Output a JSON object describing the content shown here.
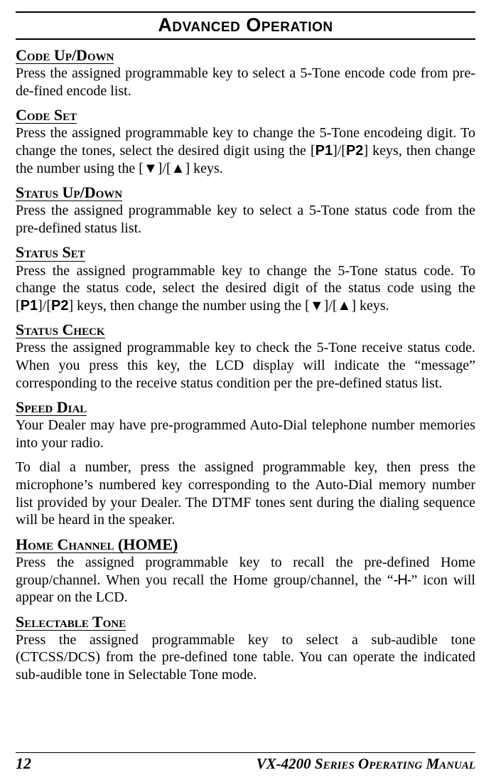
{
  "title": "Advanced Operation",
  "footer": {
    "page": "12",
    "manual": "VX-4200 Series Operating Manual"
  },
  "sections": {
    "codeUpDown": {
      "heading": "Code Up/Down",
      "p1": "Press the assigned programmable key to select a 5-Tone encode code from pre-de-fined encode list."
    },
    "codeSet": {
      "heading": "Code Set",
      "p1a": "Press the assigned programmable key to change the 5-Tone encodeing digit. To change the tones, select the desired digit using the [",
      "p1b": "]/[",
      "p1c": "] keys, then change the number using the [",
      "p1d": "]/[",
      "p1e": "] keys.",
      "keyP1": "P1",
      "keyP2": "P2"
    },
    "statusUpDown": {
      "heading": "Status Up/Down",
      "p1": "Press the assigned programmable key to select a 5-Tone status code from the pre-defined status list."
    },
    "statusSet": {
      "heading": "Status Set",
      "p1a": "Press the assigned programmable key to change the 5-Tone status code. To change the status code, select the desired digit of the status code using the [",
      "p1b": "]/[",
      "p1c": "] keys, then change the number using the [",
      "p1d": "]/[",
      "p1e": "] keys.",
      "keyP1": "P1",
      "keyP2": "P2"
    },
    "statusCheck": {
      "heading": "Status Check",
      "p1": "Press the assigned programmable key to check the 5-Tone receive status code. When you press this key, the LCD display will indicate the “message” corresponding to the receive status condition per the pre-defined status list."
    },
    "speedDial": {
      "heading": "Speed Dial",
      "p1": "Your Dealer may have pre-programmed Auto-Dial telephone number memories into your radio.",
      "p2": "To dial a number, press the assigned programmable key, then press the microphone’s numbered key corresponding to the Auto-Dial memory number list provided by your Dealer. The DTMF tones sent during the dialing sequence will be heard in the speaker."
    },
    "homeChannel": {
      "heading": "Home Channel (HOME)",
      "p1a": "Press the assigned programmable key to recall the pre-defined Home group/channel. When you recall the Home group/channel, the “",
      "p1b": "” icon will appear on the LCD.",
      "icon": "-H-"
    },
    "selectableTone": {
      "heading": "Selectable Tone",
      "p1": "Press the assigned programmable key to select a sub-audible tone (CTCSS/DCS) from the pre-defined tone table. You can operate the indicated sub-audible tone in Selectable Tone mode."
    }
  }
}
